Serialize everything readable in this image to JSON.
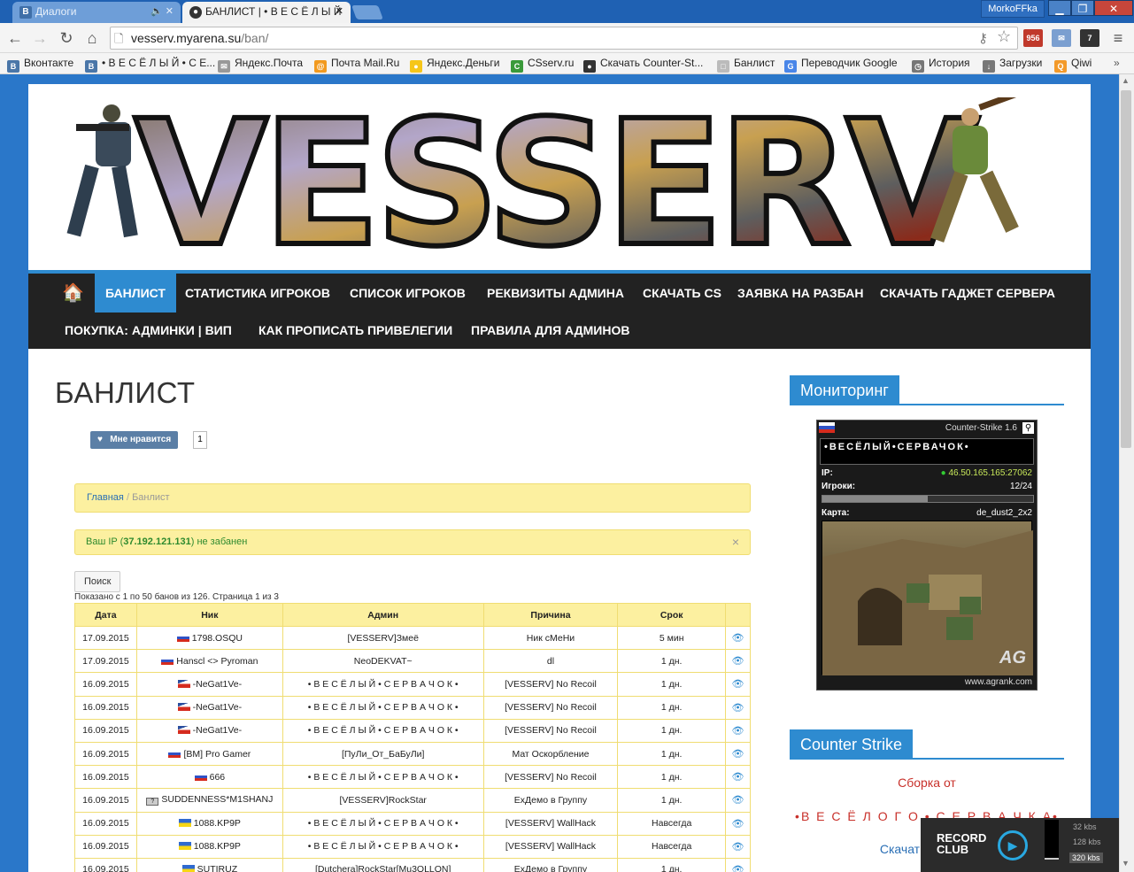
{
  "browser": {
    "tabs": [
      {
        "label": "Диалоги",
        "favicon": "В"
      },
      {
        "label": "БАНЛИСТ | • В Е С Ё Л Ы Й",
        "favicon": "●"
      }
    ],
    "profile": "MorkoFFka",
    "url_host": "vesserv.myarena.su",
    "url_path": "/ban/",
    "bookmarks": [
      {
        "label": "Вконтакте",
        "icon": "В",
        "color": "#4a76a8"
      },
      {
        "label": "• В Е С Ё Л Ы Й • С Е...",
        "icon": "В",
        "color": "#4a76a8"
      },
      {
        "label": "Яндекс.Почта",
        "icon": "✉",
        "color": "#999999"
      },
      {
        "label": "Почта Mail.Ru",
        "icon": "@",
        "color": "#f29a1f"
      },
      {
        "label": "Яндекс.Деньги",
        "icon": "●",
        "color": "#f6c619"
      },
      {
        "label": "CSserv.ru",
        "icon": "C",
        "color": "#3a9a3a"
      },
      {
        "label": "Скачать Counter-St...",
        "icon": "●",
        "color": "#333333"
      },
      {
        "label": "Банлист",
        "icon": "□",
        "color": "#bbbbbb"
      },
      {
        "label": "Переводчик Google",
        "icon": "G",
        "color": "#4a86e8"
      },
      {
        "label": "История",
        "icon": "◷",
        "color": "#777777"
      },
      {
        "label": "Загрузки",
        "icon": "↓",
        "color": "#777777"
      },
      {
        "label": "Qiwi",
        "icon": "Q",
        "color": "#f39a2a"
      }
    ],
    "ext_badges": [
      "956",
      "7"
    ]
  },
  "site": {
    "logo_text": "VESSERV",
    "menu_row1": [
      "БАНЛИСТ",
      "СТАТИСТИКА ИГРОКОВ",
      "СПИСОК ИГРОКОВ",
      "РЕКВИЗИТЫ АДМИНА",
      "СКАЧАТЬ CS",
      "ЗАЯВКА НА РАЗБАН",
      "СКАЧАТЬ ГАДЖЕТ СЕРВЕРА"
    ],
    "menu_row2": [
      "ПОКУПКА: АДМИНКИ | ВИП",
      "КАК ПРОПИСАТЬ ПРИВЕЛЕГИИ",
      "ПРАВИЛА ДЛЯ АДМИНОВ"
    ],
    "accent": "#2e8bd0"
  },
  "content": {
    "title": "БАНЛИСТ",
    "like_label": "Мне нравится",
    "like_count": "1",
    "crumb_home": "Главная",
    "crumb_sep": "/",
    "crumb_current": "Банлист",
    "ip_prefix": "Ваш IP (",
    "ip_value": "37.192.121.131",
    "ip_suffix": ") не забанен",
    "search_label": "Поиск",
    "shown_text": "Показано с 1 по 50 банов из 126. Страница 1 из 3",
    "columns": [
      "Дата",
      "Ник",
      "Админ",
      "Причина",
      "Срок"
    ],
    "rows": [
      {
        "date": "17.09.2015",
        "flag": "ru",
        "nick": "1798.OSQU",
        "admin": "[VESSERV]Змеё",
        "reason": "Ник сМеНи",
        "term": "5 мин"
      },
      {
        "date": "17.09.2015",
        "flag": "ru",
        "nick": "Hanscl <> Pyroman",
        "admin": "NeoDEKVAT~",
        "reason": "dl",
        "term": "1 дн."
      },
      {
        "date": "16.09.2015",
        "flag": "cz",
        "nick": "-NeGat1Ve-",
        "admin": "• В Е С Ё Л Ы Й • С Е Р В А Ч О К •",
        "reason": "[VESSERV] No Recoil",
        "term": "1 дн."
      },
      {
        "date": "16.09.2015",
        "flag": "cz",
        "nick": "-NeGat1Ve-",
        "admin": "• В Е С Ё Л Ы Й • С Е Р В А Ч О К •",
        "reason": "[VESSERV] No Recoil",
        "term": "1 дн."
      },
      {
        "date": "16.09.2015",
        "flag": "cz",
        "nick": "-NeGat1Ve-",
        "admin": "• В Е С Ё Л Ы Й • С Е Р В А Ч О К •",
        "reason": "[VESSERV] No Recoil",
        "term": "1 дн."
      },
      {
        "date": "16.09.2015",
        "flag": "ru",
        "nick": "[BM] Pro Gamer",
        "admin": "[ПуЛи_От_БаБуЛи]",
        "reason": "Мат Оскорбление",
        "term": "1 дн."
      },
      {
        "date": "16.09.2015",
        "flag": "ru",
        "nick": "666",
        "admin": "• В Е С Ё Л Ы Й • С Е Р В А Ч О К •",
        "reason": "[VESSERV] No Recoil",
        "term": "1 дн."
      },
      {
        "date": "16.09.2015",
        "flag": "unk",
        "nick": "SUDDENNESS*M1SHANJ",
        "admin": "[VESSERV]RockStar",
        "reason": "ExДемо в Группу",
        "term": "1 дн."
      },
      {
        "date": "16.09.2015",
        "flag": "ua",
        "nick": "1088.KP9P",
        "admin": "• В Е С Ё Л Ы Й • С Е Р В А Ч О К •",
        "reason": "[VESSERV] WallHack",
        "term": "Навсегда"
      },
      {
        "date": "16.09.2015",
        "flag": "ua",
        "nick": "1088.KP9P",
        "admin": "• В Е С Ё Л Ы Й • С Е Р В А Ч О К •",
        "reason": "[VESSERV] WallHack",
        "term": "Навсегда"
      },
      {
        "date": "16.09.2015",
        "flag": "ua",
        "nick": "SUTIRUZ",
        "admin": "[Dutchera]RockStar[Mu3OLLON]",
        "reason": "ExДемо в Группу",
        "term": "1 дн."
      }
    ]
  },
  "sidebar": {
    "monitoring_title": "Мониторинг",
    "game": "Counter-Strike 1.6",
    "server_name": "•ВЕСЁЛЫЙ•СЕРВАЧОК•",
    "ip_label": "IP:",
    "ip": "46.50.165.165:27062",
    "players_label": "Игроки:",
    "players": "12/24",
    "players_fraction": 0.5,
    "map_label": "Карта:",
    "map": "de_dust2_2x2",
    "map_brand": "AG",
    "footer_site": "www.agrank.com",
    "cs_title": "Counter Strike",
    "text1": "Сборка от",
    "text2": "•В Е С Ё Л О Г О • С Е Р В А Ч К А•",
    "text3": "Скачать Counter"
  },
  "overlay": {
    "brand_line1": "RECORD",
    "brand_line2": "CLUB",
    "rates": [
      "32 kbs",
      "128 kbs",
      "320 kbs"
    ]
  }
}
